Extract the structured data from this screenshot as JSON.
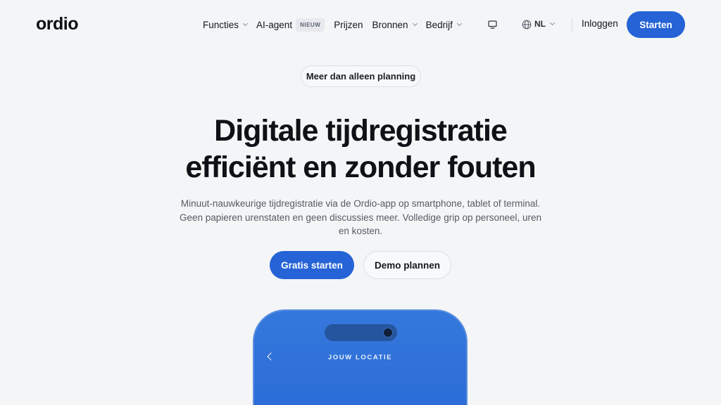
{
  "brand": {
    "logo": "ordio"
  },
  "nav": {
    "items": [
      {
        "label": "Functies",
        "dropdown": true
      },
      {
        "label": "AI-agent",
        "badge": "NIEUW",
        "dropdown": false
      },
      {
        "label": "Prijzen",
        "dropdown": false
      },
      {
        "label": "Bronnen",
        "dropdown": true
      },
      {
        "label": "Bedrijf",
        "dropdown": true
      }
    ],
    "language": "NL",
    "login_label": "Inloggen",
    "start_label": "Starten",
    "icons": [
      "monitor-icon",
      "globe-icon",
      "chevron-down-icon"
    ]
  },
  "hero": {
    "pill": "Meer dan alleen planning",
    "headline_line1": "Digitale tijdregistratie",
    "headline_line2": "efficiënt en zonder fouten",
    "subtext": "Minuut-nauwkeurige tijdregistratie via de Ordio-app op smartphone, tablet of terminal. Geen papieren urenstaten en geen discussies meer. Volledige grip op personeel, uren en kosten.",
    "primary_cta": "Gratis starten",
    "secondary_cta": "Demo plannen"
  },
  "phone": {
    "screen_title": "JOUW LOCATIE",
    "back_icon": "chevron-left-icon"
  },
  "colors": {
    "accent": "#2563d6",
    "background": "#f4f5f6",
    "text": "#111318",
    "muted_text": "#555b65"
  }
}
